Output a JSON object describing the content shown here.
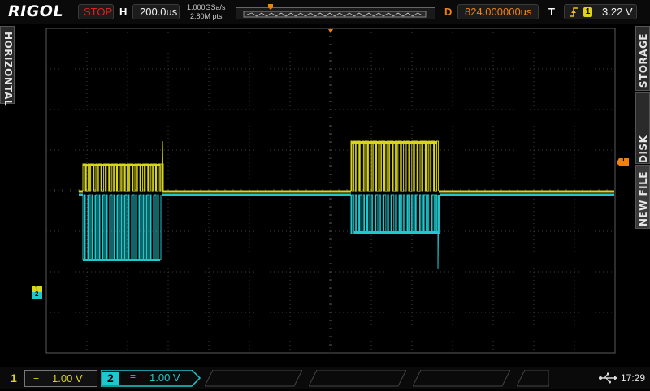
{
  "header": {
    "logo": "RIGOL",
    "run_status": "STOP",
    "timebase_label": "H",
    "timebase_value": "200.0us",
    "sample_rate": "1.000GSa/s",
    "memory_depth": "2.80M pts",
    "delay_label": "D",
    "delay_value": "824.000000us",
    "trigger_label": "T",
    "trigger_source": "1",
    "trigger_level": "3.22 V"
  },
  "side_menu": {
    "left_tab": "HORIZONTAL",
    "right_tabs": [
      "STORAGE",
      "DISK MANA",
      "NEW FILE"
    ]
  },
  "markers": {
    "trigger_marker": "T",
    "ch1_marker": "1",
    "ch2_marker": "2"
  },
  "footer": {
    "ch1_number": "1",
    "ch1_coupling": "=",
    "ch1_scale": "1.00 V",
    "ch2_number": "2",
    "ch2_coupling": "=",
    "ch2_scale": "1.00 V",
    "clock": "17:29"
  },
  "colors": {
    "ch1": "#d8d51a",
    "ch2": "#1fc8cf",
    "status_stop": "#e02020",
    "trigger_orange": "#f08010",
    "grid": "#3c3c3c"
  },
  "icons": {
    "usb": "usb-icon",
    "trigger_edge": "rising-edge-icon"
  }
}
